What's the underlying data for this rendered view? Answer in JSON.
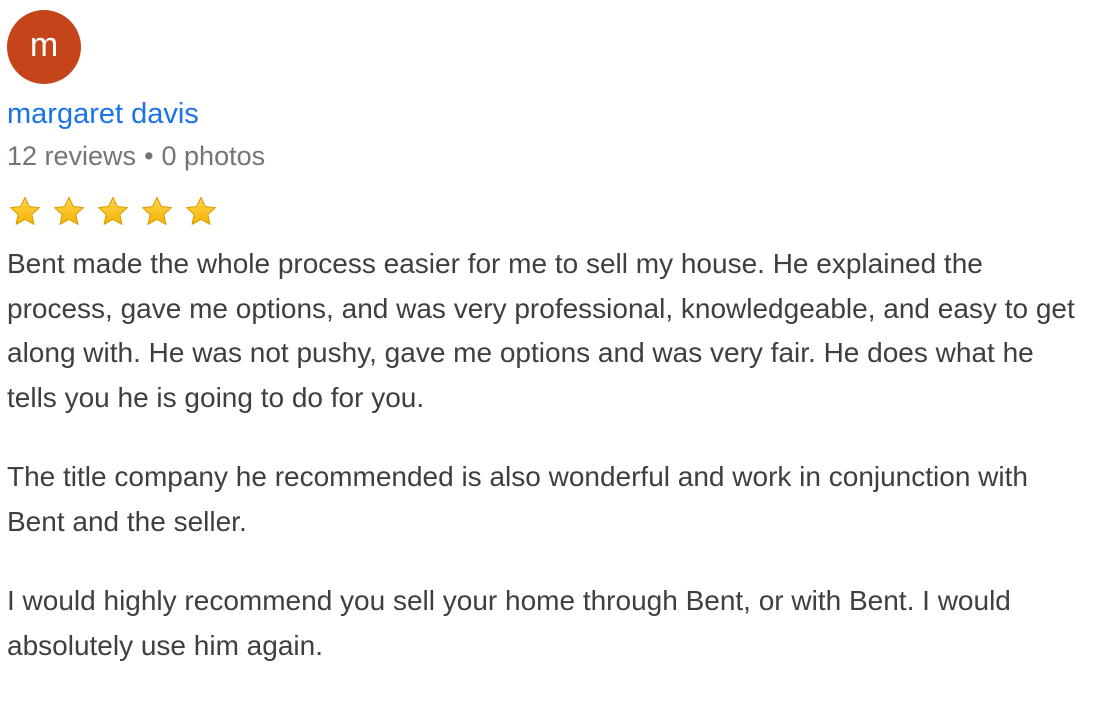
{
  "review": {
    "avatar_letter": "m",
    "avatar_color": "#c5441a",
    "author_name": "margaret davis",
    "author_color": "#1a73e8",
    "reviews_count": "12 reviews",
    "separator": "•",
    "photos_count": "0 photos",
    "rating": 5,
    "rating_max": 5,
    "star_icon": "star-icon",
    "star_color": "#f4b400",
    "paragraphs": [
      "Bent made the whole process easier for me to sell my house. He explained the process, gave me options, and was very professional, knowledgeable, and easy to get along with. He was not pushy, gave me options and was very fair. He does what he tells you he is going to do for you.",
      "The title company he recommended is also wonderful and work in conjunction with Bent and the seller.",
      "I would highly recommend you sell your home through Bent, or with Bent. I would absolutely use him again."
    ]
  }
}
